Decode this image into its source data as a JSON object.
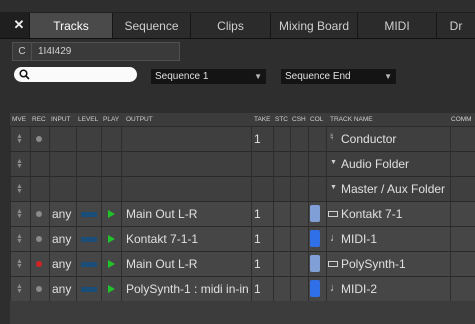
{
  "tabs": [
    {
      "label": "Tracks",
      "active": true
    },
    {
      "label": "Sequence"
    },
    {
      "label": "Clips"
    },
    {
      "label": "Mixing Board"
    },
    {
      "label": "MIDI"
    },
    {
      "label": "Dr"
    }
  ],
  "close_label": "✕",
  "position": {
    "prefix": "C",
    "value": "1I4I429"
  },
  "search": {
    "placeholder": ""
  },
  "sequence_select": "Sequence 1",
  "sequence_end_select": "Sequence End",
  "columns": [
    "MVE",
    "REC",
    "INPUT",
    "LEVEL",
    "PLAY",
    "OUTPUT",
    "TAKE",
    "STC",
    "CSH",
    "COL",
    "TRACK NAME",
    "COMM"
  ],
  "tracks": [
    {
      "name": "Conductor",
      "take": "1",
      "input": "",
      "output": "",
      "icon": "conductor-icon",
      "type": "conductor"
    },
    {
      "name": "Audio Folder",
      "take": "",
      "input": "",
      "output": "",
      "icon": "folder-arrow-icon",
      "type": "folder"
    },
    {
      "name": "Master / Aux Folder",
      "take": "",
      "input": "",
      "output": "",
      "icon": "folder-arrow-icon",
      "type": "folder"
    },
    {
      "name": "Kontakt 7-1",
      "take": "1",
      "input": "any",
      "output": "Main Out L-R",
      "icon": "instrument-icon",
      "color": "#7f9fd6",
      "rec": "#8a8a8a",
      "type": "instrument"
    },
    {
      "name": "MIDI-1",
      "take": "1",
      "input": "any",
      "output": "Kontakt 7-1-1",
      "icon": "midi-note-icon",
      "color": "#2f6fe8",
      "rec": "#8a8a8a",
      "type": "midi"
    },
    {
      "name": "PolySynth-1",
      "take": "1",
      "input": "any",
      "output": "Main Out L-R",
      "icon": "instrument-icon",
      "color": "#7f9fd6",
      "rec": "#d22222",
      "type": "instrument"
    },
    {
      "name": "MIDI-2",
      "take": "1",
      "input": "any",
      "output": "PolySynth-1 : midi in-in",
      "icon": "midi-note-icon",
      "color": "#2f6fe8",
      "rec": "#8a8a8a",
      "type": "midi"
    }
  ],
  "colors": {
    "accent": "#2f6fe8",
    "play": "#22c22a",
    "record": "#d22222",
    "level": "#1a4e78"
  }
}
